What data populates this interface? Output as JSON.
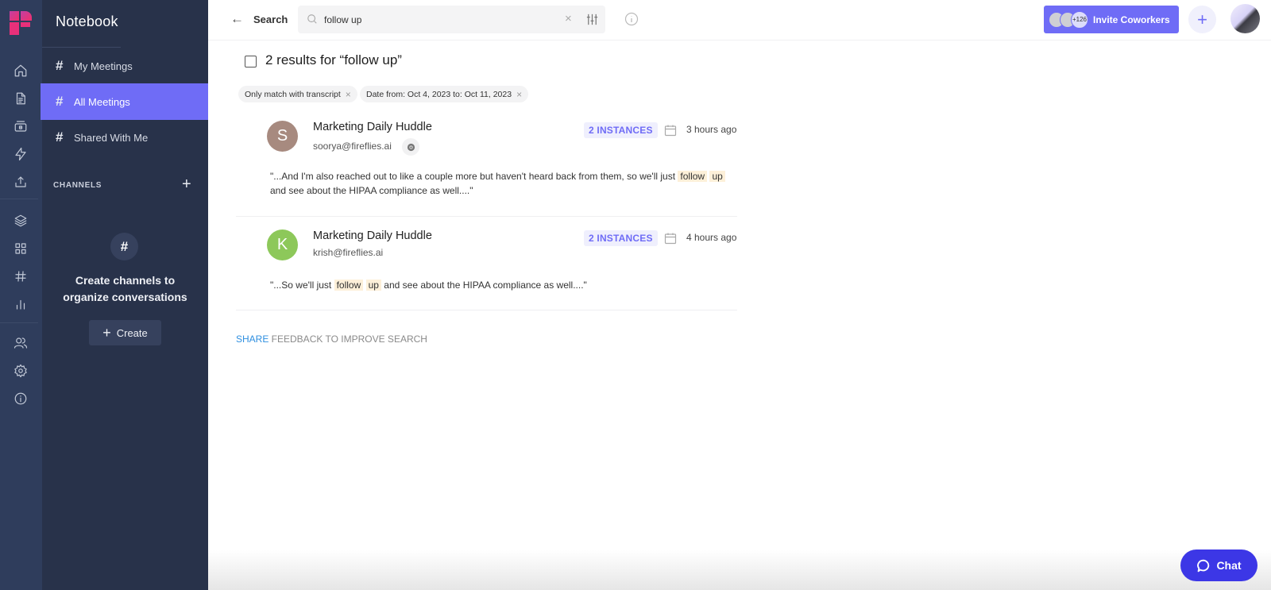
{
  "app": {
    "section_title": "Notebook"
  },
  "rail": {
    "icons": [
      "home-icon",
      "document-icon",
      "recorder-icon",
      "lightning-icon",
      "upload-icon",
      "layers-icon",
      "apps-grid-icon",
      "hashtag-icon",
      "analytics-icon",
      "team-icon",
      "settings-icon",
      "info-icon"
    ]
  },
  "panel": {
    "nav": [
      {
        "label": "My Meetings",
        "active": false
      },
      {
        "label": "All Meetings",
        "active": true
      },
      {
        "label": "Shared With Me",
        "active": false
      }
    ],
    "channels_heading": "CHANNELS",
    "channels_add": "+",
    "empty_hash": "#",
    "empty_line1": "Create channels to",
    "empty_line2": "organize conversations",
    "create_label": "Create"
  },
  "topbar": {
    "back_label": "←",
    "search_label": "Search",
    "search_value": "follow up",
    "search_placeholder": "Search",
    "clear": "×",
    "invite": {
      "more_count": "+126",
      "label": "Invite Coworkers"
    },
    "plus": "+"
  },
  "results": {
    "title": "2 results for “follow up”",
    "chips": [
      {
        "label": "Only match with transcript"
      },
      {
        "label": "Date from: Oct 4, 2023 to: Oct 11, 2023"
      }
    ],
    "items": [
      {
        "initial": "S",
        "avatar_color": "#a78a7f",
        "title": "Marketing Daily Huddle",
        "email": "soorya@fireflies.ai",
        "source_icon": "chrome-icon",
        "instances": "2 INSTANCES",
        "time": "3 hours ago",
        "snippet_before": "\"...And I'm also reached out to like a couple more but haven't heard back from them, so we'll just ",
        "hl1": "follow",
        "hl2": "up",
        "snippet_after": " and see about the HIPAA compliance as well....\""
      },
      {
        "initial": "K",
        "avatar_color": "#8dc85a",
        "title": "Marketing Daily Huddle",
        "email": "krish@fireflies.ai",
        "instances": "2 INSTANCES",
        "time": "4 hours ago",
        "snippet_before": "\"...So we'll just ",
        "hl1": "follow",
        "hl2": "up",
        "snippet_after": " and see about the HIPAA compliance as well....\""
      }
    ],
    "feedback_share": "SHARE",
    "feedback_rest": " FEEDBACK TO IMPROVE SEARCH"
  },
  "chat": {
    "label": "Chat"
  },
  "colors": {
    "accent": "#6f6cf6",
    "chat": "#3c37e6",
    "sidebar": "#28324a",
    "rail": "#2f3d5c",
    "highlight": "#fdf0d9",
    "link": "#2e8fe0"
  }
}
